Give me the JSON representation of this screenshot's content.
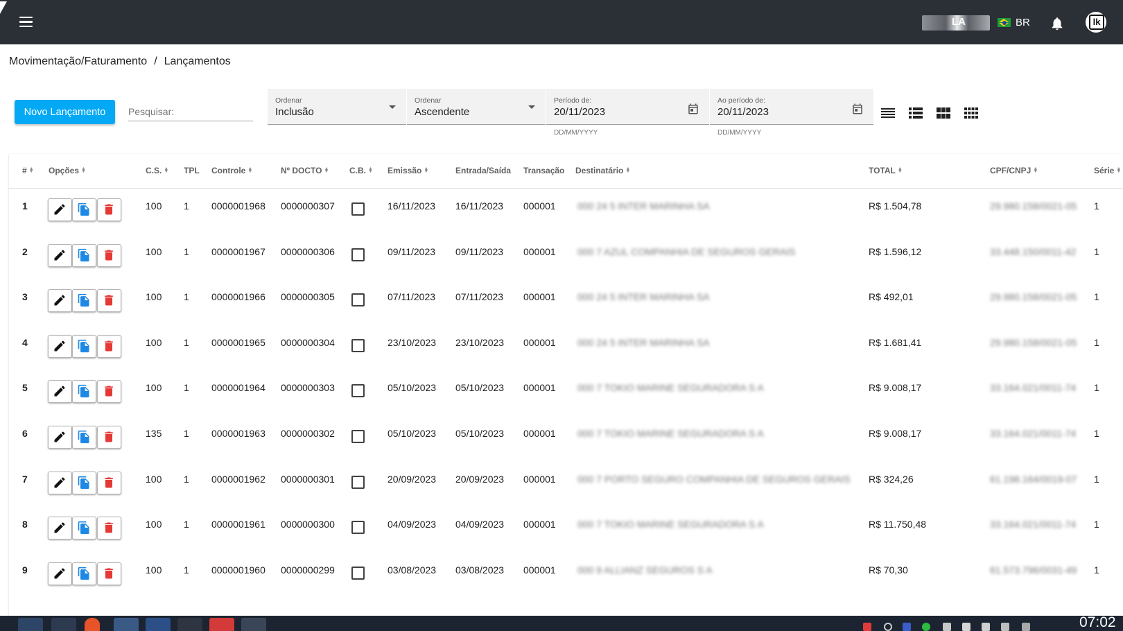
{
  "header": {
    "user_text": "LA",
    "language": "BR",
    "avatar_text": "lk"
  },
  "breadcrumb": {
    "items": [
      "Movimentação/Faturamento",
      "Lançamentos"
    ],
    "separator": "/"
  },
  "toolbar": {
    "new_button_label": "Novo Lançamento",
    "search_placeholder": "Pesquisar:",
    "order_field": {
      "label": "Ordenar",
      "value": "Inclusão"
    },
    "direction_field": {
      "label": "Ordenar",
      "value": "Ascendente"
    },
    "period_from": {
      "label": "Período de:",
      "value": "20/11/2023",
      "hint": "DD/MM/YYYY"
    },
    "period_to": {
      "label": "Ao período de:",
      "value": "20/11/2023",
      "hint": "DD/MM/YYYY"
    },
    "view_icons": [
      "view-compact-list-icon",
      "view-list-icon",
      "view-module-icon",
      "view-comfy-icon"
    ]
  },
  "table": {
    "columns": [
      "#",
      "Opções",
      "C.S.",
      "TPL",
      "Controle",
      "Nº DOCTO",
      "C.B.",
      "Emissão",
      "Entrada/Saída",
      "Transação",
      "Destinatário",
      "TOTAL",
      "CPF/CNPJ",
      "Série"
    ],
    "rows": [
      {
        "n": "1",
        "cs": "100",
        "tpl": "1",
        "controle": "0000001968",
        "docto": "0000000307",
        "emissao": "16/11/2023",
        "entrada": "16/11/2023",
        "transacao": "000001",
        "total": "R$ 1.504,78",
        "serie": "1"
      },
      {
        "n": "2",
        "cs": "100",
        "tpl": "1",
        "controle": "0000001967",
        "docto": "0000000306",
        "emissao": "09/11/2023",
        "entrada": "09/11/2023",
        "transacao": "000001",
        "total": "R$ 1.596,12",
        "serie": "1"
      },
      {
        "n": "3",
        "cs": "100",
        "tpl": "1",
        "controle": "0000001966",
        "docto": "0000000305",
        "emissao": "07/11/2023",
        "entrada": "07/11/2023",
        "transacao": "000001",
        "total": "R$ 492,01",
        "serie": "1"
      },
      {
        "n": "4",
        "cs": "100",
        "tpl": "1",
        "controle": "0000001965",
        "docto": "0000000304",
        "emissao": "23/10/2023",
        "entrada": "23/10/2023",
        "transacao": "000001",
        "total": "R$ 1.681,41",
        "serie": "1"
      },
      {
        "n": "5",
        "cs": "100",
        "tpl": "1",
        "controle": "0000001964",
        "docto": "0000000303",
        "emissao": "05/10/2023",
        "entrada": "05/10/2023",
        "transacao": "000001",
        "total": "R$ 9.008,17",
        "serie": "1"
      },
      {
        "n": "6",
        "cs": "135",
        "tpl": "1",
        "controle": "0000001963",
        "docto": "0000000302",
        "emissao": "05/10/2023",
        "entrada": "05/10/2023",
        "transacao": "000001",
        "total": "R$ 9.008,17",
        "serie": "1"
      },
      {
        "n": "7",
        "cs": "100",
        "tpl": "1",
        "controle": "0000001962",
        "docto": "0000000301",
        "emissao": "20/09/2023",
        "entrada": "20/09/2023",
        "transacao": "000001",
        "total": "R$ 324,26",
        "serie": "1"
      },
      {
        "n": "8",
        "cs": "100",
        "tpl": "1",
        "controle": "0000001961",
        "docto": "0000000300",
        "emissao": "04/09/2023",
        "entrada": "04/09/2023",
        "transacao": "000001",
        "total": "R$ 11.750,48",
        "serie": "1"
      },
      {
        "n": "9",
        "cs": "100",
        "tpl": "1",
        "controle": "0000001960",
        "docto": "0000000299",
        "emissao": "03/08/2023",
        "entrada": "03/08/2023",
        "transacao": "000001",
        "total": "R$ 70,30",
        "serie": "1"
      }
    ]
  },
  "taskbar": {
    "clock": "07:02"
  },
  "colors": {
    "topbar": "#2b2f36",
    "accent": "#03a9f4",
    "edit_icon": "#111111",
    "copy_icon": "#1e88e5",
    "delete_icon": "#e53935"
  }
}
